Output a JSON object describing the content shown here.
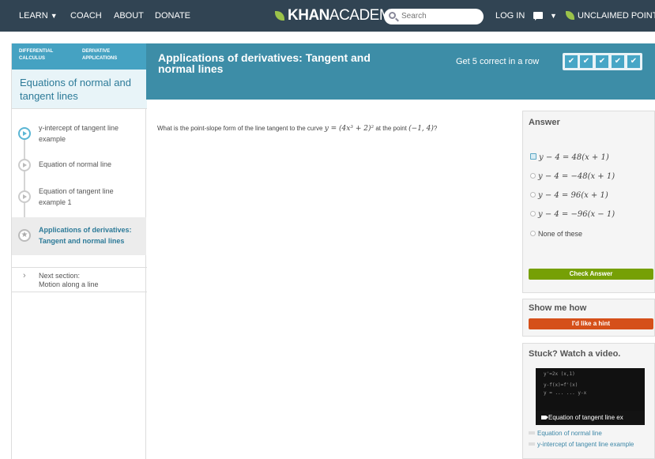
{
  "nav": {
    "learn": "LEARN",
    "coach": "COACH",
    "about": "ABOUT",
    "donate": "DONATE",
    "logo_bold": "KHAN",
    "logo_light": "ACADEMY",
    "search_placeholder": "Search",
    "login": "LOG IN",
    "points": "UNCLAIMED POINTS"
  },
  "sidebar": {
    "crumbs": [
      "DIFFERENTIAL CALCULUS",
      "DERIVATIVE APPLICATIONS"
    ],
    "topic_title": "Equations of normal and tangent lines",
    "items": [
      {
        "label": "y-intercept of tangent line example"
      },
      {
        "label": "Equation of normal line"
      },
      {
        "label": "Equation of tangent line example 1"
      },
      {
        "label": "Applications of derivatives: Tangent and normal lines"
      }
    ],
    "next_line1": "Next section:",
    "next_line2": "Motion along a line"
  },
  "header": {
    "title": "Applications of derivatives: Tangent and normal lines",
    "streak_label": "Get 5 correct in a row",
    "check_mark": "✔"
  },
  "question": {
    "prefix": "What is the point-slope form of the line tangent to the curve",
    "curve": "y = (4x³ + 2)²",
    "middle": "at the point",
    "point": "(−1, 4)",
    "suffix": "?"
  },
  "answer": {
    "heading": "Answer",
    "options": [
      "y − 4 = 48(x + 1)",
      "y − 4 = −48(x + 1)",
      "y − 4 = 96(x + 1)",
      "y − 4 = −96(x − 1)",
      "None of these"
    ],
    "check_button": "Check Answer"
  },
  "hint": {
    "heading": "Show me how",
    "button": "I'd like a hint"
  },
  "video": {
    "heading": "Stuck? Watch a video.",
    "thumb_caption": "Equation of tangent line ex",
    "links": [
      "Equation of normal line",
      "y-intercept of tangent line example"
    ]
  },
  "colors": {
    "nav_bg": "#314453",
    "header_bg": "#3d8da7",
    "crumb_bg": "#45a2c2",
    "check_green": "#76a005",
    "hint_orange": "#d5501a"
  }
}
